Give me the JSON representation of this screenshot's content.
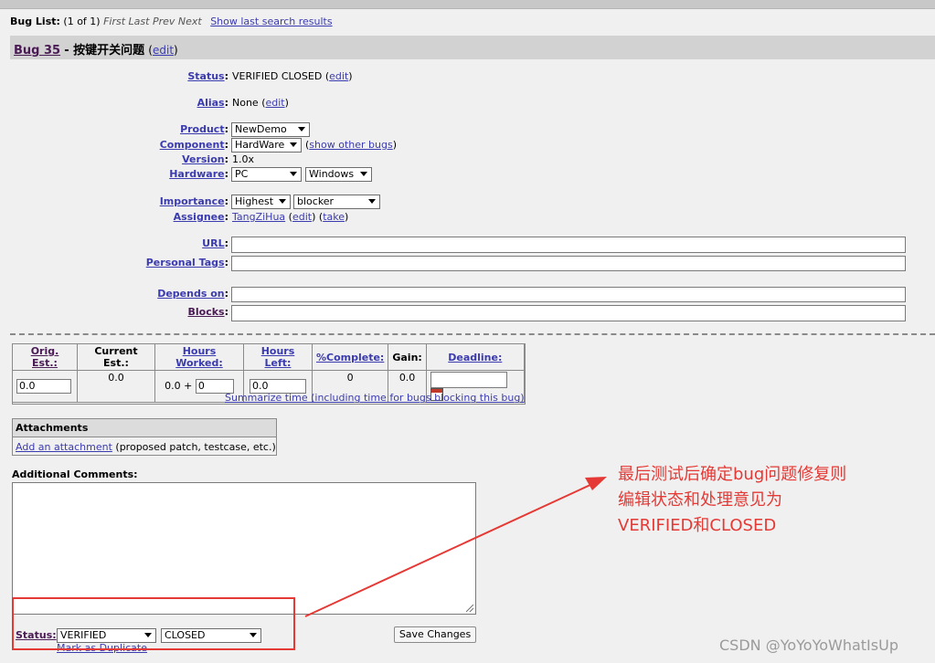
{
  "bug_list": {
    "label": "Bug List:",
    "position": "(1 of 1)",
    "nav": "First Last Prev Next",
    "show_last": "Show last search results"
  },
  "bug": {
    "id": "Bug 35",
    "title": "- 按键开关问题",
    "edit_label": "edit"
  },
  "fields": {
    "status": {
      "label": "Status",
      "value": "VERIFIED CLOSED",
      "edit": "edit"
    },
    "alias": {
      "label": "Alias",
      "value": "None",
      "edit": "edit"
    },
    "product": {
      "label": "Product",
      "value": "NewDemo"
    },
    "component": {
      "label": "Component",
      "value": "HardWare",
      "link": "show other bugs"
    },
    "version": {
      "label": "Version",
      "value": "1.0x"
    },
    "hardware": {
      "label": "Hardware",
      "value": "PC",
      "value2": "Windows"
    },
    "importance": {
      "label": "Importance",
      "value": "Highest",
      "value2": "blocker"
    },
    "assignee": {
      "label": "Assignee",
      "value": "TangZiHua",
      "edit": "edit",
      "take": "take"
    },
    "url": {
      "label": "URL"
    },
    "personal_tags": {
      "label": "Personal Tags"
    },
    "depends_on": {
      "label": "Depends on"
    },
    "blocks": {
      "label": "Blocks"
    }
  },
  "time": {
    "headers": [
      "Orig. Est.:",
      "Current Est.:",
      "Hours Worked:",
      "Hours Left:",
      "%Complete:",
      "Gain:",
      "Deadline:"
    ],
    "orig_est": "0.0",
    "current_est": "0.0",
    "hours_worked_prefix": "0.0 +",
    "hours_worked_input": "0",
    "hours_left": "0.0",
    "complete": "0",
    "gain": "0.0",
    "summarize": "Summarize time (including time for bugs blocking this bug)"
  },
  "attachments": {
    "title": "Attachments",
    "add_link": "Add an attachment",
    "note": "(proposed patch, testcase, etc.)"
  },
  "comments": {
    "label": "Additional Comments:"
  },
  "bottom": {
    "status_label": "Status:",
    "status_value": "VERIFIED",
    "resolution_value": "CLOSED",
    "save": "Save Changes",
    "mark_dup": "Mark as Duplicate"
  },
  "annotation": {
    "line1": "最后测试后确定bug问题修复则",
    "line2": "编辑状态和处理意见为",
    "line3": "VERIFIED和CLOSED",
    "color": "#e53935"
  },
  "watermark": "CSDN @YoYoYoWhatIsUp"
}
